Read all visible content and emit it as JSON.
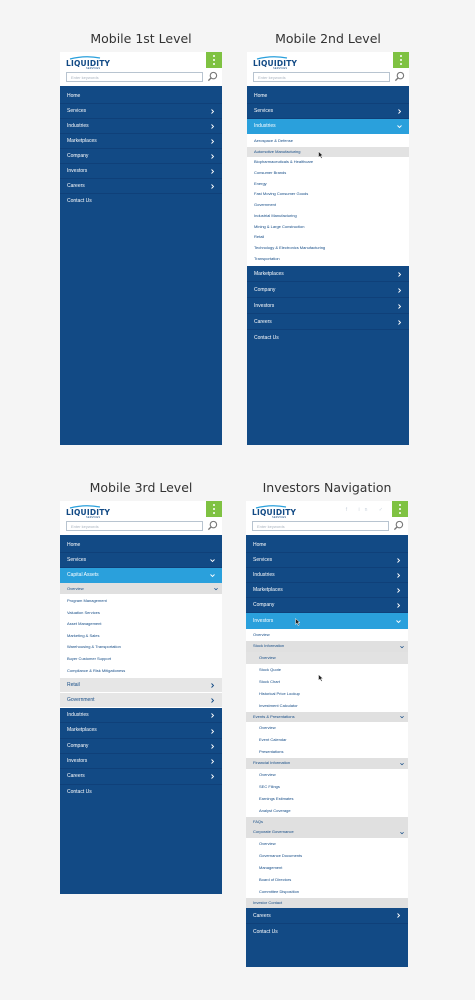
{
  "labels": {
    "p1": "Mobile 1st Level",
    "p2": "Mobile 2nd Level",
    "p3": "Mobile 3rd Level",
    "p4": "Investors Navigation"
  },
  "brand": {
    "name": "LIQUIDITY",
    "sub": "SERVICES",
    "accent": "#7fc242",
    "navy": "#124a85",
    "highlight": "#2aa0dc"
  },
  "search": {
    "placeholder": "Enter keywords"
  },
  "social": "f in ✓",
  "panel1": {
    "nav": [
      "Home",
      "Services",
      "Industries",
      "Marketplaces",
      "Company",
      "Investors",
      "Careers",
      "Contact Us"
    ]
  },
  "panel2": {
    "top": [
      "Home",
      "Services"
    ],
    "active": "Industries",
    "sub": [
      "Aerospace & Defense",
      "Automotive Manufacturing",
      "Biopharmaceuticals & Healthcare",
      "Consumer Brands",
      "Energy",
      "Fast Moving Consumer Goods",
      "Government",
      "Industrial Manufacturing",
      "Mining & Large Construction",
      "Retail",
      "Technology & Electronics Manufacturing",
      "Transportation"
    ],
    "rest": [
      "Marketplaces",
      "Company",
      "Investors",
      "Careers",
      "Contact Us"
    ]
  },
  "panel3": {
    "top": [
      "Home",
      "Services"
    ],
    "active": "Capital Assets",
    "overview": "Overview",
    "sub": [
      "Program Management",
      "Valuation Services",
      "Asset Management",
      "Marketing & Sales",
      "Warehousing & Transportation",
      "Buyer Customer Support",
      "Compliance & Risk Mitigationess"
    ],
    "secondary": [
      "Retail",
      "Government"
    ],
    "rest": [
      "Industries",
      "Marketplaces",
      "Company",
      "Investors",
      "Careers",
      "Contact Us"
    ]
  },
  "panel4": {
    "top": [
      "Home",
      "Services",
      "Industries",
      "Marketplaces",
      "Company"
    ],
    "active": "Investors",
    "overview": "Overview",
    "groups": [
      {
        "title": "Stock Information",
        "items": [
          "Overview",
          "Stock Quote",
          "Stock Chart",
          "Historical Price Lookup",
          "Investment Calculator"
        ]
      },
      {
        "title": "Events & Presentations",
        "items": [
          "Overview",
          "Event Calendar",
          "Presentations"
        ]
      },
      {
        "title": "Financial Information",
        "items": [
          "Overview",
          "SEC Filings",
          "Earnings Estimates",
          "Analyst Coverage"
        ]
      }
    ],
    "faqs": "FAQs",
    "governance": {
      "title": "Corporate Governance",
      "items": [
        "Overview",
        "Governance Documents",
        "Management",
        "Board of Directors",
        "Committee Disposition"
      ]
    },
    "contact": "Investor Contact",
    "rest": [
      "Careers",
      "Contact Us"
    ]
  }
}
